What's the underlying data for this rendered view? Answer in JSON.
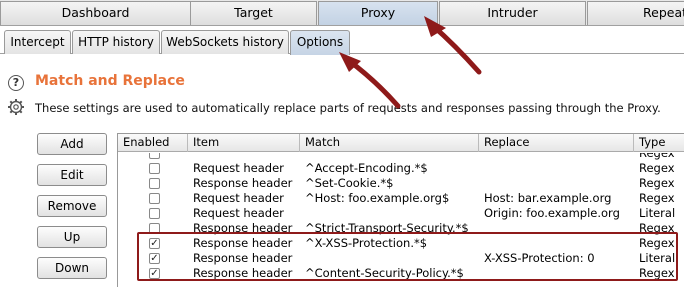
{
  "top_tabs": [
    "Dashboard",
    "Target",
    "Proxy",
    "Intruder",
    "Repeater"
  ],
  "sub_tabs": [
    "Intercept",
    "HTTP history",
    "WebSockets history",
    "Options"
  ],
  "section": {
    "title": "Match and Replace",
    "description": "These settings are used to automatically replace parts of requests and responses passing through the Proxy."
  },
  "buttons": {
    "add": "Add",
    "edit": "Edit",
    "remove": "Remove",
    "up": "Up",
    "down": "Down"
  },
  "table": {
    "columns": [
      "Enabled",
      "Item",
      "Match",
      "Replace",
      "Type"
    ],
    "rows": [
      {
        "enabled": false,
        "item": "",
        "match": "",
        "replace": "",
        "type": "Regex"
      },
      {
        "enabled": false,
        "item": "Request header",
        "match": "^Accept-Encoding.*$",
        "replace": "",
        "type": "Regex"
      },
      {
        "enabled": false,
        "item": "Response header",
        "match": "^Set-Cookie.*$",
        "replace": "",
        "type": "Regex"
      },
      {
        "enabled": false,
        "item": "Request header",
        "match": "^Host: foo.example.org$",
        "replace": "Host: bar.example.org",
        "type": "Regex"
      },
      {
        "enabled": false,
        "item": "Request header",
        "match": "",
        "replace": "Origin: foo.example.org",
        "type": "Literal"
      },
      {
        "enabled": false,
        "item": "Response header",
        "match": "^Strict-Transport-Security.*$",
        "replace": "",
        "type": "Regex"
      },
      {
        "enabled": true,
        "item": "Response header",
        "match": "^X-XSS-Protection.*$",
        "replace": "",
        "type": "Regex"
      },
      {
        "enabled": true,
        "item": "Response header",
        "match": "",
        "replace": "X-XSS-Protection: 0",
        "type": "Literal"
      },
      {
        "enabled": true,
        "item": "Response header",
        "match": "^Content-Security-Policy.*$",
        "replace": "",
        "type": "Regex"
      }
    ]
  },
  "colors": {
    "accent_title": "#e8733a",
    "annotation": "#8e1a1a"
  },
  "icons": [
    "help-icon",
    "gear-icon",
    "annotation-arrow"
  ]
}
